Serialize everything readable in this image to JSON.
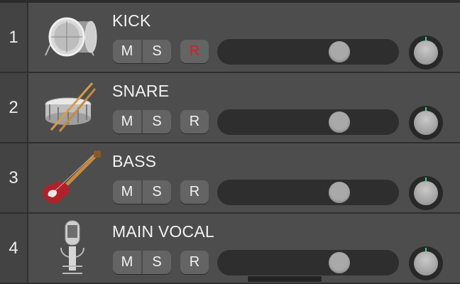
{
  "tracks": [
    {
      "number": "1",
      "name": "KICK",
      "instrument_icon": "kick-drum-icon",
      "mute_label": "M",
      "solo_label": "S",
      "record_label": "R",
      "record_armed": true,
      "volume_fraction": 0.7
    },
    {
      "number": "2",
      "name": "SNARE",
      "instrument_icon": "snare-drum-icon",
      "mute_label": "M",
      "solo_label": "S",
      "record_label": "R",
      "record_armed": false,
      "volume_fraction": 0.7
    },
    {
      "number": "3",
      "name": "BASS",
      "instrument_icon": "bass-guitar-icon",
      "mute_label": "M",
      "solo_label": "S",
      "record_label": "R",
      "record_armed": false,
      "volume_fraction": 0.7
    },
    {
      "number": "4",
      "name": "MAIN VOCAL",
      "instrument_icon": "microphone-icon",
      "mute_label": "M",
      "solo_label": "S",
      "record_label": "R",
      "record_armed": false,
      "volume_fraction": 0.7
    }
  ],
  "colors": {
    "record_armed": "#d61e1e",
    "record_idle": "#f2f2f2",
    "knob_indicator": "#2fe07a"
  }
}
